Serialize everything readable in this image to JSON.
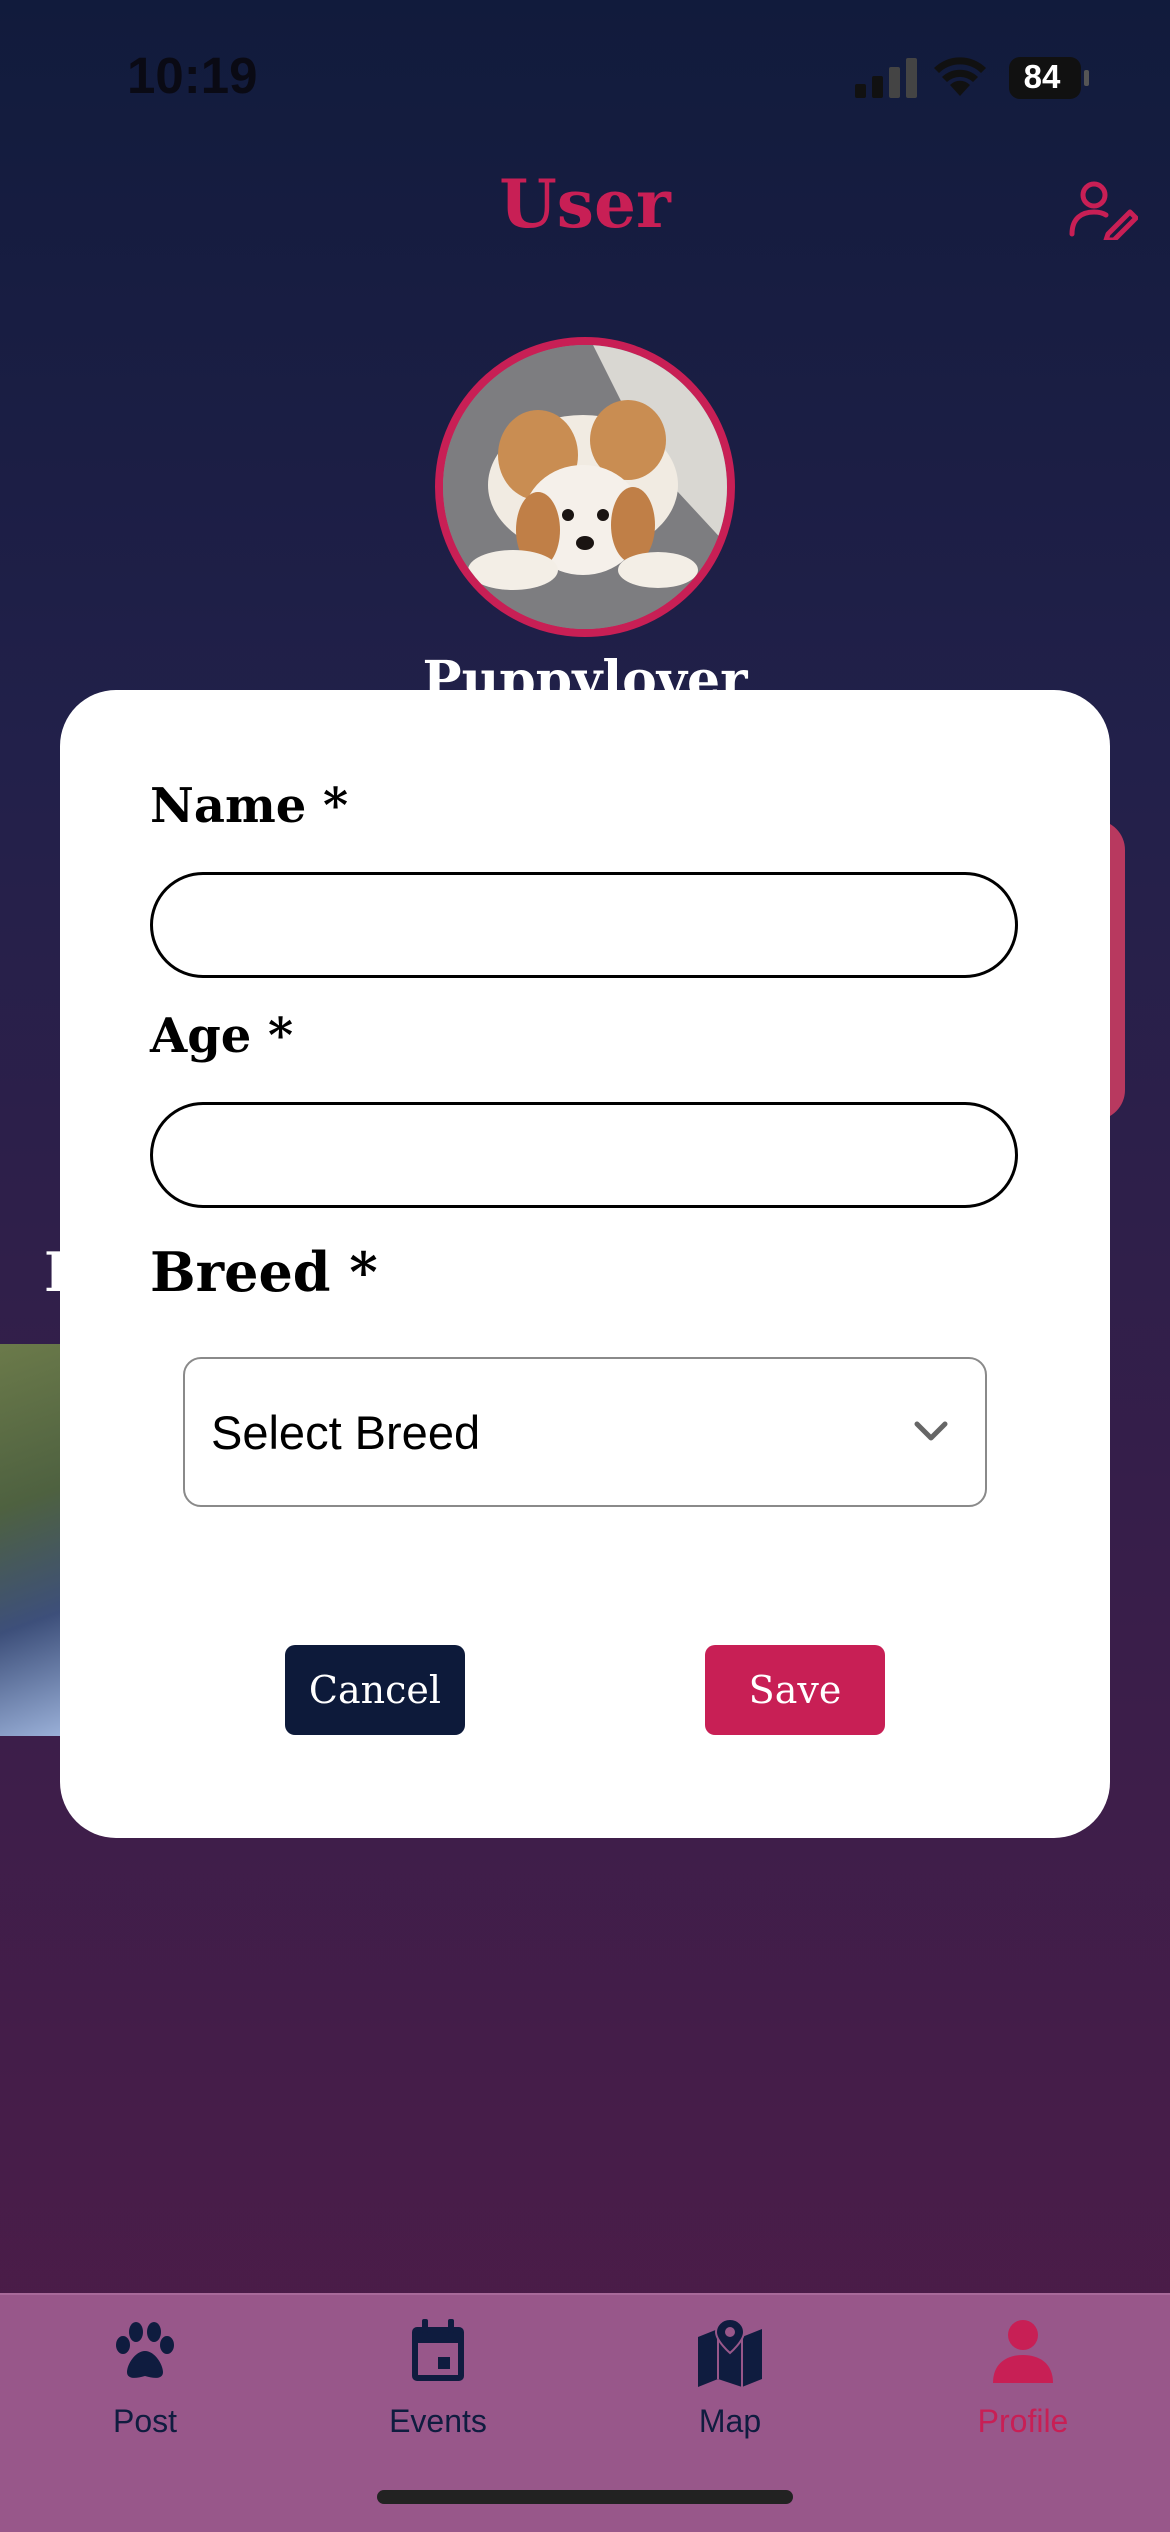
{
  "status_bar": {
    "time": "10:19",
    "battery": "84"
  },
  "header": {
    "title": "User",
    "edit_icon": "edit-profile-icon"
  },
  "profile": {
    "username": "Puppylover"
  },
  "background": {
    "partial_letter": "F"
  },
  "modal": {
    "name_label": "Name *",
    "name_value": "",
    "age_label": "Age *",
    "age_value": "",
    "breed_label": "Breed *",
    "breed_placeholder": "Select Breed",
    "cancel_label": "Cancel",
    "save_label": "Save"
  },
  "nav": {
    "items": [
      {
        "label": "Post",
        "icon": "paw-icon",
        "active": false
      },
      {
        "label": "Events",
        "icon": "calendar-icon",
        "active": false
      },
      {
        "label": "Map",
        "icon": "map-icon",
        "active": false
      },
      {
        "label": "Profile",
        "icon": "person-icon",
        "active": true
      }
    ]
  },
  "colors": {
    "accent": "#c81f55",
    "navy": "#0d1a3a",
    "nav_bg": "#98578a"
  }
}
